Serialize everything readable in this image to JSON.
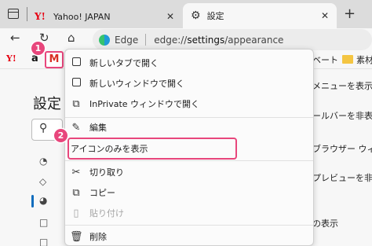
{
  "tabs": [
    {
      "title": "Yahoo! JAPAN",
      "favicon": "Y!"
    },
    {
      "title": "設定"
    }
  ],
  "address": {
    "brand": "Edge",
    "url_prefix": "edge://",
    "url_path": "settings",
    "url_rest": "/appearance"
  },
  "favorites": {
    "yahoo": "Y!",
    "amazon": "a",
    "gmail": "M",
    "partial_label": "ベート",
    "folder_label": "素材"
  },
  "settings": {
    "title": "設定",
    "right_lines": [
      "メニューを表示",
      "ールバーを非表示",
      "ブラウザー ウィン",
      "プレビューを非表",
      "の表示"
    ]
  },
  "menu": {
    "items": [
      {
        "icon": "new-tab-icon",
        "label": "新しいタブで開く"
      },
      {
        "icon": "new-window-icon",
        "label": "新しいウィンドウで開く"
      },
      {
        "icon": "inprivate-window-icon",
        "label": "InPrivate ウィンドウで開く"
      },
      {
        "icon": "pencil-icon",
        "label": "編集"
      },
      {
        "icon": "",
        "label": "アイコンのみを表示"
      },
      {
        "icon": "scissors-icon",
        "label": "切り取り"
      },
      {
        "icon": "copy-icon",
        "label": "コピー"
      },
      {
        "icon": "paste-icon",
        "label": "貼り付け",
        "disabled": true
      },
      {
        "icon": "trash-icon",
        "label": "削除"
      }
    ]
  },
  "badges": [
    "1",
    "2"
  ],
  "colors": {
    "accent": "#e8467c",
    "yahoo_red": "#e60012",
    "edge_blue": "#0f6cbd"
  }
}
